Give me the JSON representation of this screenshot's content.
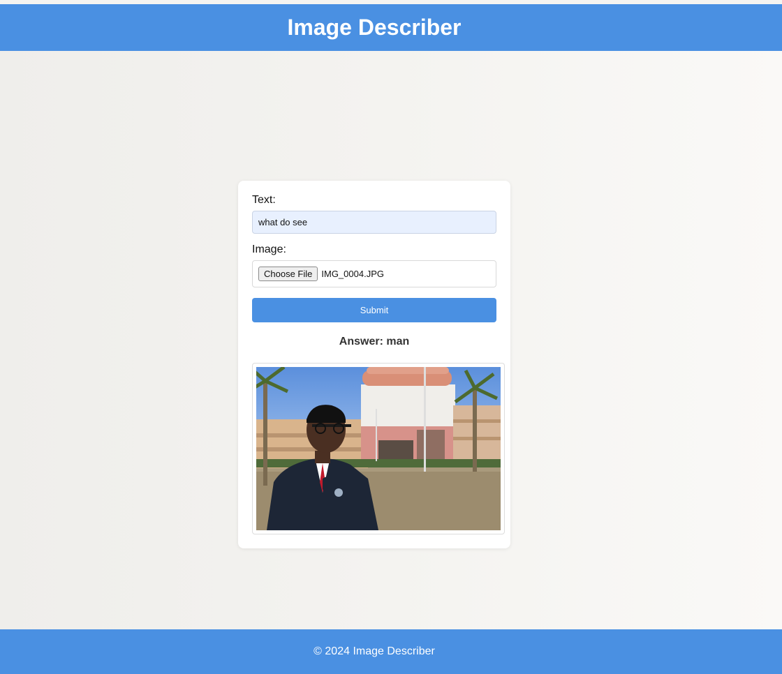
{
  "header": {
    "title": "Image Describer"
  },
  "form": {
    "text_label": "Text:",
    "text_value": "what do see",
    "image_label": "Image:",
    "choose_file_label": "Choose File",
    "file_name": "IMG_0004.JPG",
    "submit_label": "Submit"
  },
  "result": {
    "answer": "Answer: man"
  },
  "footer": {
    "text": "© 2024 Image Describer"
  },
  "colors": {
    "accent": "#4a90e2",
    "input_bg": "#e8f0fe",
    "card_bg": "#ffffff"
  }
}
